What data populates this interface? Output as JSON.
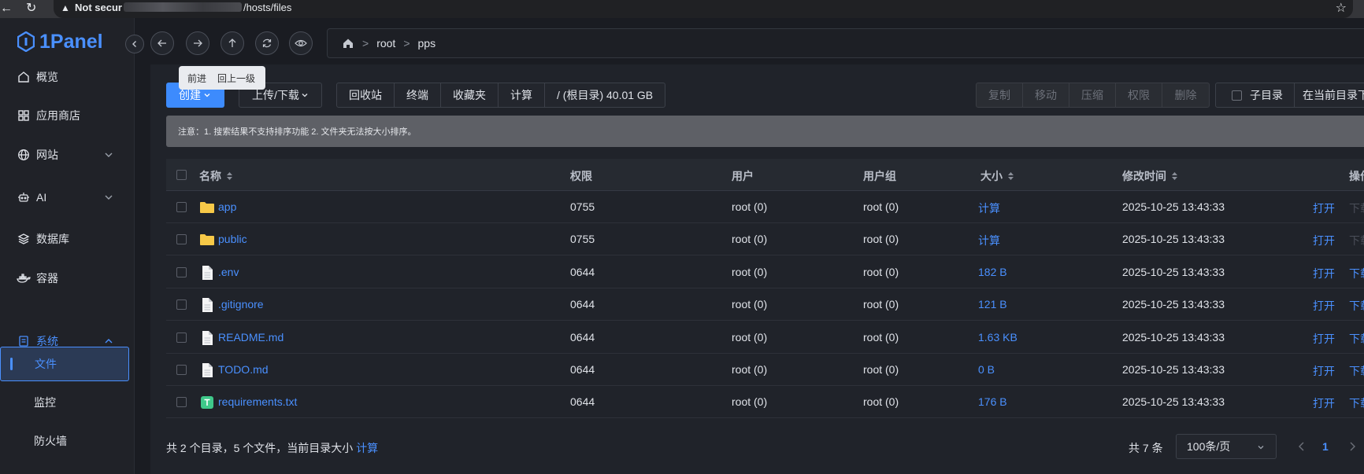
{
  "browser": {
    "url_prefix": "Not secur",
    "url_suffix": "/hosts/files"
  },
  "app": {
    "logo_text": "1Panel"
  },
  "sidebar": {
    "items": [
      {
        "label": "概览",
        "icon": "home-icon"
      },
      {
        "label": "应用商店",
        "icon": "grid-icon"
      },
      {
        "label": "网站",
        "icon": "globe-icon"
      },
      {
        "label": "AI",
        "icon": "robot-icon"
      },
      {
        "label": "数据库",
        "icon": "database-layers-icon"
      },
      {
        "label": "容器",
        "icon": "docker-icon"
      },
      {
        "label": "系统",
        "icon": "system-icon"
      }
    ],
    "sub_items": [
      {
        "label": "文件"
      },
      {
        "label": "监控"
      },
      {
        "label": "防火墙"
      }
    ]
  },
  "breadcrumb": {
    "parts": [
      "root",
      "pps"
    ]
  },
  "tooltip": {
    "forward": "前进",
    "up": "回上一级"
  },
  "toolbar": {
    "create": "创建",
    "upload": "上传/下载",
    "recycle": "回收站",
    "terminal": "终端",
    "favorites": "收藏夹",
    "calculate": "计算",
    "disk": "/ (根目录) 40.01 GB",
    "copy": "复制",
    "move": "移动",
    "compress": "压缩",
    "permission": "权限",
    "delete": "删除",
    "subdir": "子目录",
    "search_in": "在当前目录下"
  },
  "notice": "注意：1. 搜索结果不支持排序功能 2. 文件夹无法按大小排序。",
  "table": {
    "headers": {
      "name": "名称",
      "perm": "权限",
      "user": "用户",
      "group": "用户组",
      "size": "大小",
      "mtime": "修改时间",
      "ops": "操作"
    },
    "open_label": "打开",
    "download_label": "下载",
    "rows": [
      {
        "name": "app",
        "type": "folder",
        "perm": "0755",
        "user": "root (0)",
        "group": "root (0)",
        "size": "计算",
        "mtime": "2025-10-25 13:43:33"
      },
      {
        "name": "public",
        "type": "folder",
        "perm": "0755",
        "user": "root (0)",
        "group": "root (0)",
        "size": "计算",
        "mtime": "2025-10-25 13:43:33"
      },
      {
        "name": ".env",
        "type": "file",
        "perm": "0644",
        "user": "root (0)",
        "group": "root (0)",
        "size": "182 B",
        "mtime": "2025-10-25 13:43:33"
      },
      {
        "name": ".gitignore",
        "type": "file",
        "perm": "0644",
        "user": "root (0)",
        "group": "root (0)",
        "size": "121 B",
        "mtime": "2025-10-25 13:43:33"
      },
      {
        "name": "README.md",
        "type": "file",
        "perm": "0644",
        "user": "root (0)",
        "group": "root (0)",
        "size": "1.63 KB",
        "mtime": "2025-10-25 13:43:33"
      },
      {
        "name": "TODO.md",
        "type": "file",
        "perm": "0644",
        "user": "root (0)",
        "group": "root (0)",
        "size": "0 B",
        "mtime": "2025-10-25 13:43:33"
      },
      {
        "name": "requirements.txt",
        "type": "text",
        "perm": "0644",
        "user": "root (0)",
        "group": "root (0)",
        "size": "176 B",
        "mtime": "2025-10-25 13:43:33"
      }
    ]
  },
  "footer": {
    "summary": "共 2 个目录，5 个文件，当前目录大小",
    "calc": "计算",
    "total": "共 7 条",
    "page_size": "100条/页",
    "page": "1"
  },
  "colors": {
    "accent": "#4a90ff",
    "create_btn": "#3d8bfd",
    "folder": "#f7c948",
    "text_file": "#3fc88a"
  }
}
